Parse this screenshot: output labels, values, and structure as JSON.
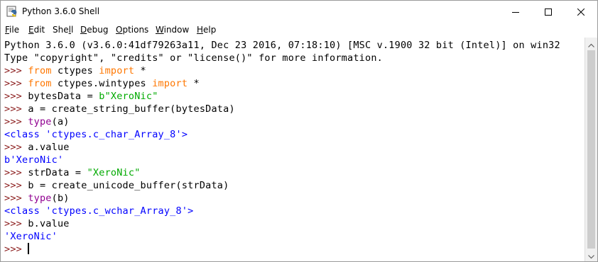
{
  "window": {
    "title": "Python 3.6.0 Shell"
  },
  "menu": [
    {
      "pre": "",
      "ul": "F",
      "post": "ile"
    },
    {
      "pre": "",
      "ul": "E",
      "post": "dit"
    },
    {
      "pre": "She",
      "ul": "l",
      "post": "l"
    },
    {
      "pre": "",
      "ul": "D",
      "post": "ebug"
    },
    {
      "pre": "",
      "ul": "O",
      "post": "ptions"
    },
    {
      "pre": "",
      "ul": "W",
      "post": "indow"
    },
    {
      "pre": "",
      "ul": "H",
      "post": "elp"
    }
  ],
  "shell": {
    "lines": [
      [
        {
          "t": "Python 3.6.0 (v3.6.0:41df79263a11, Dec 23 2016, 07:18:10) [MSC v.1900 32 bit (Intel)] on win32",
          "c": "plain"
        }
      ],
      [
        {
          "t": "Type \"copyright\", \"credits\" or \"license()\" for more information.",
          "c": "plain"
        }
      ],
      [
        {
          "t": ">>> ",
          "c": "prompt"
        },
        {
          "t": "from",
          "c": "kw"
        },
        {
          "t": " ctypes ",
          "c": "plain"
        },
        {
          "t": "import",
          "c": "kw"
        },
        {
          "t": " *",
          "c": "plain"
        }
      ],
      [
        {
          "t": ">>> ",
          "c": "prompt"
        },
        {
          "t": "from",
          "c": "kw"
        },
        {
          "t": " ctypes.wintypes ",
          "c": "plain"
        },
        {
          "t": "import",
          "c": "kw"
        },
        {
          "t": " *",
          "c": "plain"
        }
      ],
      [
        {
          "t": ">>> ",
          "c": "prompt"
        },
        {
          "t": "bytesData = ",
          "c": "plain"
        },
        {
          "t": "b\"XeroNic\"",
          "c": "str"
        }
      ],
      [
        {
          "t": ">>> ",
          "c": "prompt"
        },
        {
          "t": "a = create_string_buffer(bytesData)",
          "c": "plain"
        }
      ],
      [
        {
          "t": ">>> ",
          "c": "prompt"
        },
        {
          "t": "type",
          "c": "builtin"
        },
        {
          "t": "(a)",
          "c": "plain"
        }
      ],
      [
        {
          "t": "<class 'ctypes.c_char_Array_8'>",
          "c": "out"
        }
      ],
      [
        {
          "t": ">>> ",
          "c": "prompt"
        },
        {
          "t": "a.value",
          "c": "plain"
        }
      ],
      [
        {
          "t": "b'XeroNic'",
          "c": "out"
        }
      ],
      [
        {
          "t": ">>> ",
          "c": "prompt"
        },
        {
          "t": "strData = ",
          "c": "plain"
        },
        {
          "t": "\"XeroNic\"",
          "c": "str"
        }
      ],
      [
        {
          "t": ">>> ",
          "c": "prompt"
        },
        {
          "t": "b = create_unicode_buffer(strData)",
          "c": "plain"
        }
      ],
      [
        {
          "t": ">>> ",
          "c": "prompt"
        },
        {
          "t": "type",
          "c": "builtin"
        },
        {
          "t": "(b)",
          "c": "plain"
        }
      ],
      [
        {
          "t": "<class 'ctypes.c_wchar_Array_8'>",
          "c": "out"
        }
      ],
      [
        {
          "t": ">>> ",
          "c": "prompt"
        },
        {
          "t": "b.value",
          "c": "plain"
        }
      ],
      [
        {
          "t": "'XeroNic'",
          "c": "out"
        }
      ],
      [
        {
          "t": ">>> ",
          "c": "prompt"
        }
      ]
    ]
  },
  "colors": {
    "prompt": "#8b1c1c",
    "keyword": "#ff7700",
    "builtin": "#900090",
    "string": "#00aa00",
    "output": "#0000ff"
  },
  "icons": {
    "app": "python-idle-icon",
    "minimize": "minimize-icon",
    "maximize": "maximize-icon",
    "close": "close-icon"
  }
}
